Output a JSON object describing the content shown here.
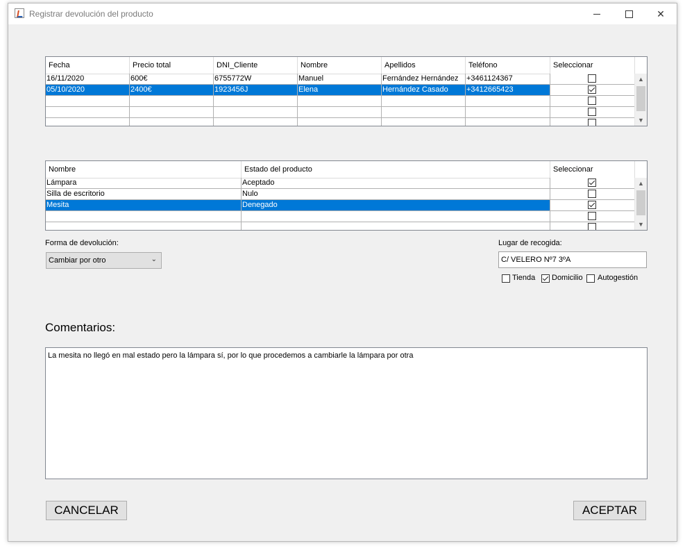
{
  "window": {
    "title": "Registrar devolución del producto"
  },
  "ventas_table": {
    "columns": [
      "Fecha",
      "Precio total",
      "DNI_Cliente",
      "Nombre",
      "Apellidos",
      "Teléfono",
      "Seleccionar"
    ],
    "rows": [
      {
        "cells": [
          "16/11/2020",
          "600€",
          "6755772W",
          "Manuel",
          "Fernández Hernández",
          "+3461124367"
        ],
        "checked": false,
        "selected": false
      },
      {
        "cells": [
          "05/10/2020",
          "2400€",
          "1923456J",
          "Elena",
          "Hernández Casado",
          "+3412665423"
        ],
        "checked": true,
        "selected": true
      },
      {
        "cells": [
          "",
          "",
          "",
          "",
          "",
          ""
        ],
        "checked": false,
        "selected": false
      },
      {
        "cells": [
          "",
          "",
          "",
          "",
          "",
          ""
        ],
        "checked": false,
        "selected": false
      },
      {
        "cells": [
          "",
          "",
          "",
          "",
          "",
          ""
        ],
        "checked": false,
        "selected": false
      }
    ]
  },
  "productos_table": {
    "columns": [
      "Nombre",
      "Estado del producto",
      "Seleccionar"
    ],
    "rows": [
      {
        "cells": [
          "Lámpara",
          "Aceptado"
        ],
        "checked": true,
        "selected": false
      },
      {
        "cells": [
          "Silla de escritorio",
          "Nulo"
        ],
        "checked": false,
        "selected": false
      },
      {
        "cells": [
          "Mesita",
          "Denegado"
        ],
        "checked": true,
        "selected": true
      },
      {
        "cells": [
          "",
          ""
        ],
        "checked": false,
        "selected": false
      },
      {
        "cells": [
          "",
          ""
        ],
        "checked": false,
        "selected": false
      }
    ]
  },
  "forma_devolucion": {
    "label": "Forma de devolución:",
    "value": "Cambiar por otro"
  },
  "lugar_recogida": {
    "label": "Lugar de recogida:",
    "value": "C/ VELERO Nº7 3ºA",
    "options": [
      {
        "label": "Tienda",
        "checked": false
      },
      {
        "label": "Domicilio",
        "checked": true
      },
      {
        "label": "Autogestión",
        "checked": false
      }
    ]
  },
  "comentarios": {
    "label": "Comentarios:",
    "text": "La mesita no llegó en mal estado pero la lámpara sí, por lo que procedemos a cambiarle la lámpara por otra"
  },
  "buttons": {
    "cancel": "CANCELAR",
    "accept": "ACEPTAR"
  },
  "colors": {
    "selection": "#0078d7",
    "window_bg": "#f0f0f0"
  }
}
